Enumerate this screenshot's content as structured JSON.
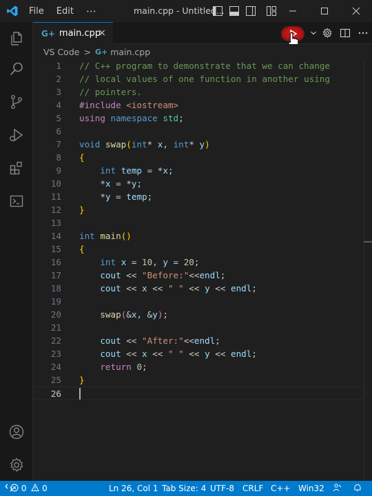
{
  "titlebar": {
    "menu": [
      "File",
      "Edit",
      "⋯"
    ],
    "title": "main.cpp - Untitled..."
  },
  "tab": {
    "label": "main.cpp",
    "close": "×"
  },
  "breadcrumb": {
    "root": "VS Code",
    "separator": ">",
    "file": "main.cpp"
  },
  "editor": {
    "lines": [
      {
        "n": "1"
      },
      {
        "n": "2"
      },
      {
        "n": "3"
      },
      {
        "n": "4"
      },
      {
        "n": "5"
      },
      {
        "n": "6"
      },
      {
        "n": "7"
      },
      {
        "n": "8"
      },
      {
        "n": "9"
      },
      {
        "n": "10"
      },
      {
        "n": "11"
      },
      {
        "n": "12"
      },
      {
        "n": "13"
      },
      {
        "n": "14"
      },
      {
        "n": "15"
      },
      {
        "n": "16"
      },
      {
        "n": "17"
      },
      {
        "n": "18"
      },
      {
        "n": "19"
      },
      {
        "n": "20"
      },
      {
        "n": "21"
      },
      {
        "n": "22"
      },
      {
        "n": "23"
      },
      {
        "n": "24"
      },
      {
        "n": "25"
      },
      {
        "n": "26"
      }
    ],
    "code": {
      "l1": "// C++ program to demonstrate that we can change",
      "l2": "// local values of one function in another using",
      "l3": "// pointers.",
      "l4_dir": "#include",
      "l4_hdr": "<iostream>",
      "l5_using": "using",
      "l5_namespace": "namespace",
      "l5_std": "std",
      "l5_semi": ";",
      "l7_void": "void",
      "l7_fn": "swap",
      "l7_p1": "(",
      "l7_int1": "int",
      "l7_star1": "* ",
      "l7_x": "x",
      "l7_comma": ", ",
      "l7_int2": "int",
      "l7_star2": "* ",
      "l7_y": "y",
      "l7_p2": ")",
      "l8": "{",
      "l9_int": "int",
      "l9_temp": "temp",
      "l9_rest": " = *",
      "l9_x": "x",
      "l9_semi": ";",
      "l10_a": "*",
      "l10_x": "x",
      "l10_b": " = *",
      "l10_y": "y",
      "l10_semi": ";",
      "l11_a": "*",
      "l11_y": "y",
      "l11_b": " = ",
      "l11_temp": "temp",
      "l11_semi": ";",
      "l12": "}",
      "l14_int": "int",
      "l14_fn": "main",
      "l14_p": "()",
      "l15": "{",
      "l16_int": "int",
      "l16_x": "x",
      "l16_eq1": " = ",
      "l16_n10": "10",
      "l16_comma": ", ",
      "l16_y": "y",
      "l16_eq2": " = ",
      "l16_n20": "20",
      "l16_semi": ";",
      "l17_cout": "cout",
      "l17_op": " << ",
      "l17_str": "\"Before:\"",
      "l17_op2": "<<",
      "l17_endl": "endl",
      "l17_semi": ";",
      "l18_cout": "cout",
      "l18_op1": " << ",
      "l18_x": "x",
      "l18_op2": " << ",
      "l18_str": "\" \"",
      "l18_op3": " << ",
      "l18_y": "y",
      "l18_op4": " << ",
      "l18_endl": "endl",
      "l18_semi": ";",
      "l20_fn": "swap",
      "l20_p1": "(",
      "l20_a1": "&",
      "l20_x": "x",
      "l20_comma": ", &",
      "l20_y": "y",
      "l20_p2": ")",
      "l20_semi": ";",
      "l22_cout": "cout",
      "l22_op": " << ",
      "l22_str": "\"After:\"",
      "l22_op2": "<<",
      "l22_endl": "endl",
      "l22_semi": ";",
      "l23_cout": "cout",
      "l23_op1": " << ",
      "l23_x": "x",
      "l23_op2": " << ",
      "l23_str": "\" \"",
      "l23_op3": " << ",
      "l23_y": "y",
      "l23_op4": " << ",
      "l23_endl": "endl",
      "l23_semi": ";",
      "l24_ret": "return",
      "l24_sp": " ",
      "l24_zero": "0",
      "l24_semi": ";",
      "l25": "}"
    }
  },
  "statusbar": {
    "errors": "0",
    "warnings": "0",
    "position": "Ln 26, Col 1",
    "tabsize": "Tab Size: 4",
    "encoding": "UTF-8",
    "eol": "CRLF",
    "language": "C++",
    "platform": "Win32"
  },
  "colors": {
    "accent": "#007acc",
    "run_highlight": "#d81b1b"
  },
  "icons": [
    "vscode-logo-icon",
    "explorer-icon",
    "search-icon",
    "source-control-icon",
    "run-debug-icon",
    "extensions-icon",
    "terminal-icon",
    "account-icon",
    "manage-gear-icon",
    "run-icon",
    "settings-gear-icon",
    "split-editor-icon",
    "more-actions-icon"
  ]
}
